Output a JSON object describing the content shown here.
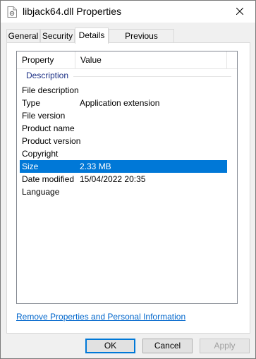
{
  "window": {
    "title": "libjack64.dll Properties",
    "icon": "dll-file-icon"
  },
  "tabs": [
    {
      "label": "General"
    },
    {
      "label": "Security"
    },
    {
      "label": "Details",
      "active": true
    },
    {
      "label": "Previous Versions"
    }
  ],
  "details": {
    "columns": [
      "Property",
      "Value"
    ],
    "group": "Description",
    "rows": [
      {
        "property": "File description",
        "value": ""
      },
      {
        "property": "Type",
        "value": "Application extension"
      },
      {
        "property": "File version",
        "value": ""
      },
      {
        "property": "Product name",
        "value": ""
      },
      {
        "property": "Product version",
        "value": ""
      },
      {
        "property": "Copyright",
        "value": ""
      },
      {
        "property": "Size",
        "value": "2.33 MB",
        "selected": true
      },
      {
        "property": "Date modified",
        "value": "15/04/2022 20:35"
      },
      {
        "property": "Language",
        "value": ""
      }
    ],
    "selection_color": "#0078d7"
  },
  "link": "Remove Properties and Personal Information",
  "buttons": {
    "ok": "OK",
    "cancel": "Cancel",
    "apply": "Apply"
  }
}
